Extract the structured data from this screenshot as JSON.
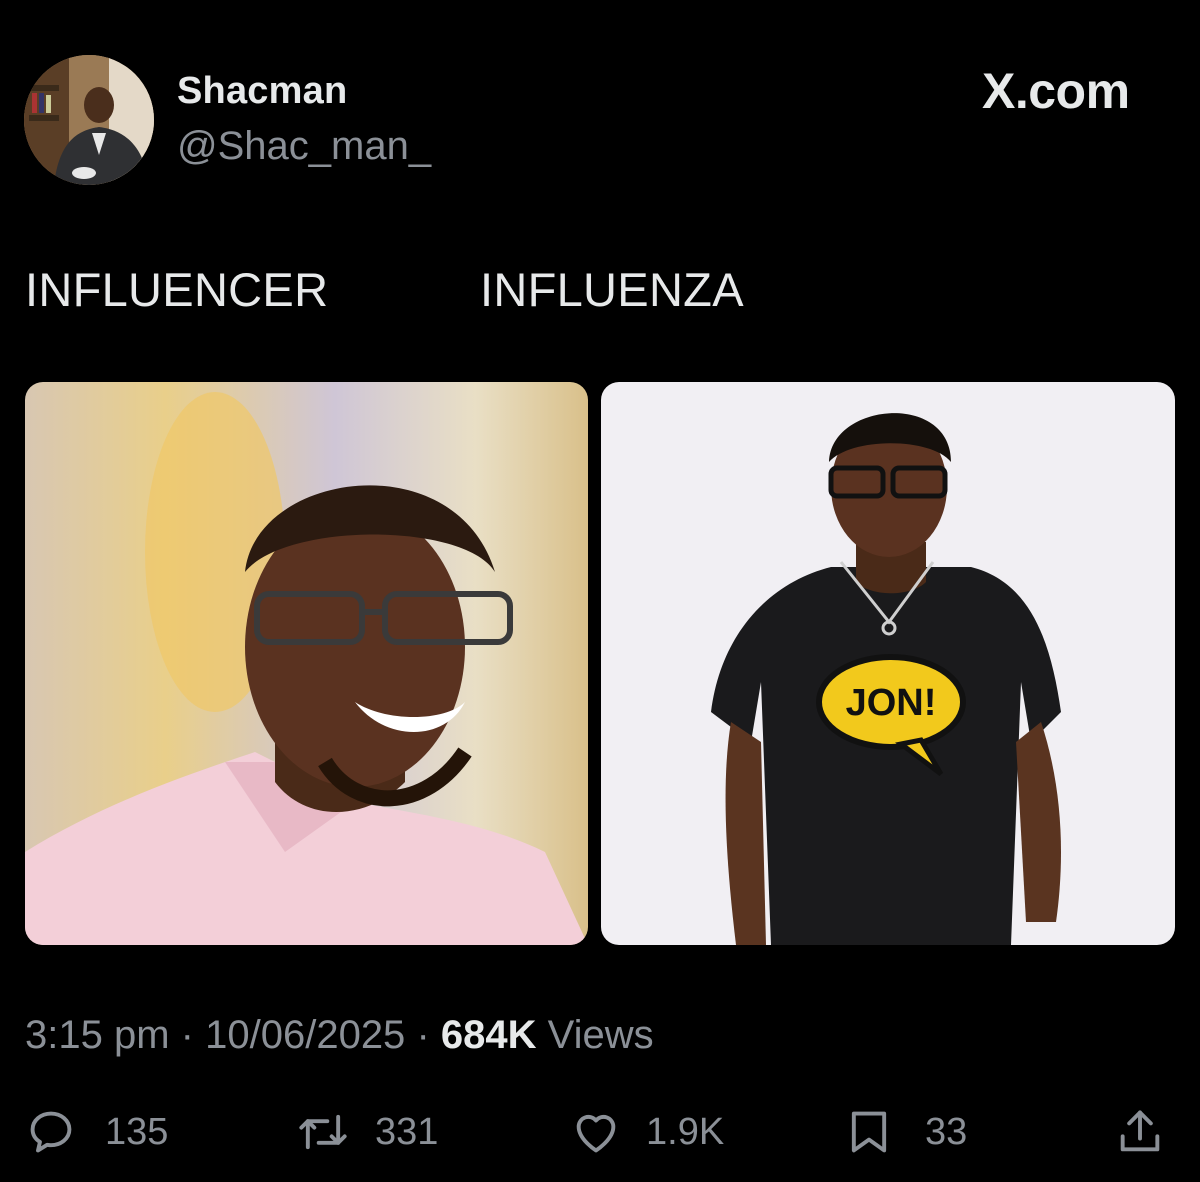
{
  "post": {
    "author": {
      "display_name": "Shacman",
      "handle": "@Shac_man_"
    },
    "watermark": "X.com",
    "captions": {
      "left": "INFLUENCER",
      "right": "INFLUENZA"
    },
    "images": [
      {
        "icon": "photo-smiling-man-pink-shirt"
      },
      {
        "icon": "photo-man-black-tshirt-jon-logo",
        "shirt_logo_text": "JON!"
      }
    ],
    "time": "3:15 pm",
    "separator": "·",
    "date": "10/06/2025",
    "views_count": "684K",
    "views_label": "Views",
    "actions": {
      "replies": {
        "icon": "reply-icon",
        "count": "135"
      },
      "reposts": {
        "icon": "repost-icon",
        "count": "331"
      },
      "likes": {
        "icon": "heart-icon",
        "count": "1.9K"
      },
      "bookmarks": {
        "icon": "bookmark-icon",
        "count": "33"
      },
      "share": {
        "icon": "share-icon"
      }
    }
  },
  "colors": {
    "background": "#000000",
    "primary_text": "#e7e9ea",
    "secondary_text": "#8b9097",
    "logo_yellow": "#f2c91c"
  }
}
